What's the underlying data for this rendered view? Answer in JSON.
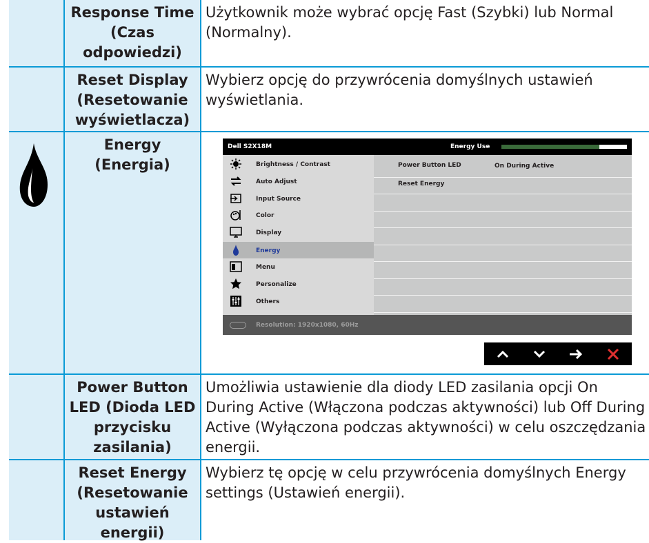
{
  "rows": [
    {
      "label": "Response Time (Czas odpowiedzi)",
      "desc": "Użytkownik może wybrać opcję Fast (Szybki) lub Normal (Normalny)."
    },
    {
      "label": "Reset Display (Resetowanie wyświetlacza)",
      "desc": "Wybierz opcję do przywrócenia domyślnych ustawień wyświetlania."
    },
    {
      "label": "Energy (Energia)",
      "icon": "energy-flame-icon"
    },
    {
      "label": "Power Button LED (Dioda LED przycisku zasilania)",
      "desc": "Umożliwia ustawienie dla diody LED zasilania opcji On During Active (Włączona podczas aktywności) lub Off During Active (Wyłączona podczas aktywności) w celu oszczędzania energii."
    },
    {
      "label": "Reset Energy (Resetowanie ustawień energii)",
      "desc": "Wybierz tę opcję w celu przywrócenia domyślnych Energy settings (Ustawień energii)."
    }
  ],
  "osd": {
    "model": "Dell S2X18M",
    "energy_use_label": "Energy Use",
    "energy_use_level": 0.78,
    "menu": [
      {
        "label": "Brightness / Contrast",
        "icon": "brightness-icon"
      },
      {
        "label": "Auto Adjust",
        "icon": "auto-adjust-icon"
      },
      {
        "label": "Input Source",
        "icon": "input-source-icon"
      },
      {
        "label": "Color",
        "icon": "color-icon"
      },
      {
        "label": "Display",
        "icon": "display-icon"
      },
      {
        "label": "Energy",
        "icon": "energy-icon",
        "active": true
      },
      {
        "label": "Menu",
        "icon": "menu-icon"
      },
      {
        "label": "Personalize",
        "icon": "star-icon"
      },
      {
        "label": "Others",
        "icon": "others-icon"
      }
    ],
    "panel": {
      "power_led_label": "Power Button LED",
      "power_led_value": "On During Active",
      "reset_energy_label": "Reset Energy"
    },
    "resolution": "Resolution: 1920x1080, 60Hz",
    "nav_buttons": [
      "up-icon",
      "down-icon",
      "right-arrow-icon",
      "close-icon"
    ]
  },
  "colors": {
    "table_border": "#0a9ad6",
    "header_fill": "#dbeef8",
    "active_menu_text": "#1f3a9a",
    "close_red": "#e03030"
  }
}
